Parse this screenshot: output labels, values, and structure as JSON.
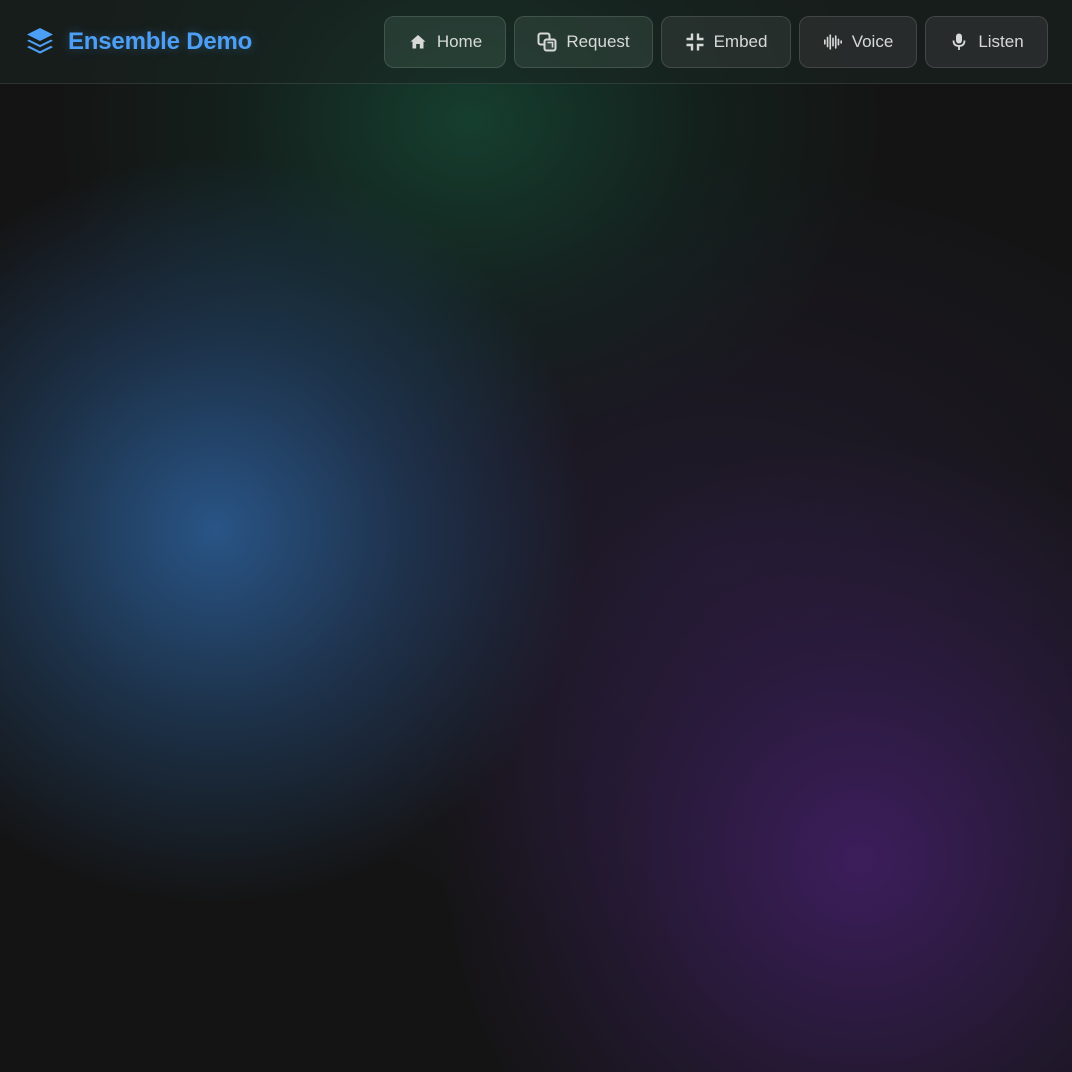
{
  "app": {
    "title": "Ensemble Demo",
    "brand_icon": "layers-icon",
    "brand_color": "#4d9ff5"
  },
  "nav": {
    "items": [
      {
        "label": "Home",
        "icon": "home-icon"
      },
      {
        "label": "Request",
        "icon": "request-icon"
      },
      {
        "label": "Embed",
        "icon": "compress-icon"
      },
      {
        "label": "Voice",
        "icon": "waveform-icon"
      },
      {
        "label": "Listen",
        "icon": "microphone-icon"
      }
    ]
  },
  "colors": {
    "background": "#141414",
    "glow_blue": "#2a588c",
    "glow_purple": "#3e1e5f",
    "glow_green": "#16463a",
    "nav_text": "#d6d9d8"
  }
}
